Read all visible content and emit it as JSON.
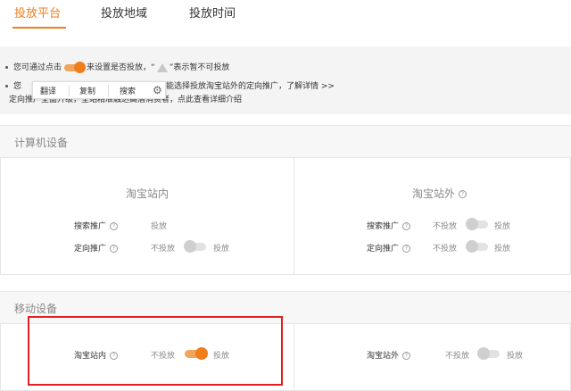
{
  "tabs": [
    {
      "label": "投放平台",
      "active": true
    },
    {
      "label": "投放地域",
      "active": false
    },
    {
      "label": "投放时间",
      "active": false
    }
  ],
  "info": {
    "line1_prefix": "您可通过点击",
    "line1_middle": "来设置是否投放，“",
    "line1_suffix": "”表示暂不可投放",
    "line2_prefix": "您",
    "line2_text": "能选择投放淘宝站外的定向推广，了解详情 >>",
    "line3_text": "定向推广全面升级，全站精准触达高潜消费者，点此查看详细介绍"
  },
  "popup": {
    "translate": "翻译",
    "copy": "复制",
    "search": "搜索",
    "settings_icon": "gear-icon"
  },
  "sections": {
    "computer": {
      "title": "计算机设备",
      "inner": {
        "title": "淘宝站内",
        "rows": [
          {
            "label": "搜索推广",
            "off_text": "",
            "on_text": "投放",
            "toggle": false
          },
          {
            "label": "定向推广",
            "off_text": "不投放",
            "on_text": "投放",
            "toggle": true,
            "state": "off"
          }
        ]
      },
      "outer": {
        "title": "淘宝站外",
        "rows": [
          {
            "label": "搜索推广",
            "off_text": "不投放",
            "on_text": "投放",
            "toggle": true,
            "state": "off"
          },
          {
            "label": "定向推广",
            "off_text": "不投放",
            "on_text": "投放",
            "toggle": true,
            "state": "off"
          }
        ]
      }
    },
    "mobile": {
      "title": "移动设备",
      "inner": {
        "label": "淘宝站内",
        "off_text": "不投放",
        "on_text": "投放",
        "state": "on"
      },
      "outer": {
        "label": "淘宝站外",
        "off_text": "不投放",
        "on_text": "投放",
        "state": "off"
      }
    }
  },
  "colors": {
    "accent": "#f07d1c",
    "highlight": "#e02020"
  }
}
